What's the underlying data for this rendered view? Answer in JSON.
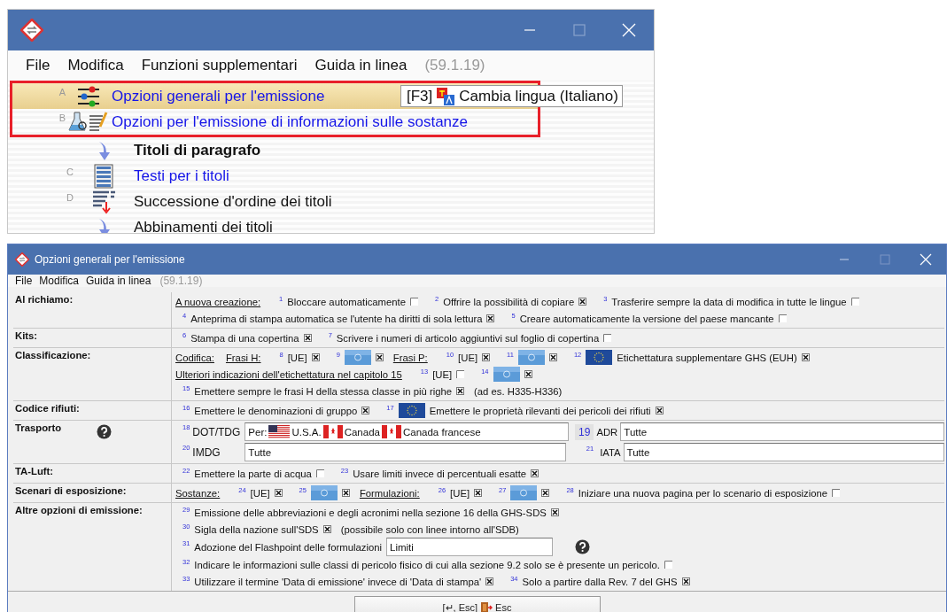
{
  "top_window": {
    "menu": [
      "File",
      "Modifica",
      "Funzioni supplementari",
      "Guida in linea"
    ],
    "version": "(59.1.19)",
    "highlighted_items": [
      {
        "letter": "A",
        "label": "Opzioni generali per l'emissione",
        "kind": "sliders",
        "selected": true
      },
      {
        "letter": "B",
        "label": "Opzioni per l'emissione di informazioni sulle sostanze",
        "kind": "flask",
        "selected": false
      }
    ],
    "items": [
      {
        "label": "Titoli di paragrafo",
        "kind": "heading",
        "selected": false
      },
      {
        "letter": "C",
        "label": "Testi per i titoli",
        "kind": "list",
        "selected": false
      },
      {
        "letter": "D",
        "label": "Successione d'ordine dei titoli",
        "kind": "sort",
        "selected": false
      },
      {
        "label": "Abbinamenti dei titoli",
        "kind": "merge",
        "selected": false
      }
    ],
    "tooltip": {
      "shortcut": "[F3]",
      "text": "Cambia lingua (Italiano)"
    }
  },
  "bottom_window": {
    "title": "Opzioni generali per l'emissione",
    "menu": [
      "File",
      "Modifica",
      "Guida in linea"
    ],
    "version": "(59.1.19)",
    "sections": [
      {
        "label": "Al richiamo:",
        "help": false,
        "lines": [
          [
            {
              "kind": "label",
              "text": "A nuova creazione:"
            },
            {
              "kind": "num",
              "text": "1"
            },
            {
              "kind": "text",
              "text": "Bloccare automaticamente"
            },
            {
              "kind": "check",
              "checked": false
            },
            {
              "kind": "num",
              "text": "2"
            },
            {
              "kind": "text",
              "text": "Offrire la possibilità di copiare"
            },
            {
              "kind": "check",
              "checked": true
            },
            {
              "kind": "num",
              "text": "3"
            },
            {
              "kind": "text",
              "text": "Trasferire sempre la data di modifica in tutte le lingue"
            },
            {
              "kind": "check",
              "checked": false
            }
          ],
          [
            {
              "kind": "num",
              "text": "4"
            },
            {
              "kind": "text",
              "text": "Anteprima di stampa automatica se l'utente ha diritti di sola lettura"
            },
            {
              "kind": "check",
              "checked": true
            },
            {
              "kind": "num",
              "text": "5"
            },
            {
              "kind": "text",
              "text": "Creare automaticamente la versione del paese mancante"
            },
            {
              "kind": "check",
              "checked": false
            }
          ]
        ]
      },
      {
        "label": "Kits:",
        "help": false,
        "lines": [
          [
            {
              "kind": "num",
              "text": "6"
            },
            {
              "kind": "text",
              "text": "Stampa di una copertina"
            },
            {
              "kind": "check",
              "checked": true
            },
            {
              "kind": "num",
              "text": "7"
            },
            {
              "kind": "text",
              "text": "Scrivere i numeri di articolo aggiuntivi sul foglio di copertina"
            },
            {
              "kind": "check",
              "checked": false
            }
          ]
        ]
      },
      {
        "label": "Classificazione:",
        "help": false,
        "lines": [
          [
            {
              "kind": "label",
              "text": "Codifica:"
            },
            {
              "kind": "label",
              "text": "Frasi H:"
            },
            {
              "kind": "num",
              "text": "8"
            },
            {
              "kind": "text",
              "text": "[UE]"
            },
            {
              "kind": "check",
              "checked": true
            },
            {
              "kind": "num",
              "text": "9"
            },
            {
              "kind": "un-flag"
            },
            {
              "kind": "check",
              "checked": true
            },
            {
              "kind": "label",
              "text": "Frasi P:"
            },
            {
              "kind": "num",
              "text": "10"
            },
            {
              "kind": "text",
              "text": "[UE]"
            },
            {
              "kind": "check",
              "checked": true
            },
            {
              "kind": "num",
              "text": "11"
            },
            {
              "kind": "un-flag"
            },
            {
              "kind": "check",
              "checked": true
            },
            {
              "kind": "num",
              "text": "12"
            },
            {
              "kind": "eu-flag"
            },
            {
              "kind": "text",
              "text": "Etichettatura supplementare GHS (EUH)"
            },
            {
              "kind": "check",
              "checked": true
            }
          ],
          [
            {
              "kind": "label",
              "text": "Ulteriori indicazioni dell'etichettatura nel capitolo 15"
            },
            {
              "kind": "num",
              "text": "13"
            },
            {
              "kind": "text",
              "text": "[UE]"
            },
            {
              "kind": "check",
              "checked": false
            },
            {
              "kind": "num",
              "text": "14"
            },
            {
              "kind": "un-flag"
            },
            {
              "kind": "check",
              "checked": true
            }
          ],
          [
            {
              "kind": "num",
              "text": "15"
            },
            {
              "kind": "text",
              "text": "Emettere sempre le frasi H della stessa classe in più righe"
            },
            {
              "kind": "check",
              "checked": true
            },
            {
              "kind": "text",
              "text": "(ad es. H335-H336)"
            }
          ]
        ]
      },
      {
        "label": "Codice rifiuti:",
        "help": false,
        "lines": [
          [
            {
              "kind": "num",
              "text": "16"
            },
            {
              "kind": "text",
              "text": "Emettere le denominazioni di gruppo"
            },
            {
              "kind": "check",
              "checked": true
            },
            {
              "kind": "num",
              "text": "17"
            },
            {
              "kind": "eu-flag"
            },
            {
              "kind": "text",
              "text": "Emettere le proprietà rilevanti dei pericoli dei rifiuti"
            },
            {
              "kind": "check",
              "checked": true
            }
          ]
        ]
      },
      {
        "label": "Trasporto",
        "help": true,
        "lines": [
          [
            {
              "kind": "num",
              "text": "18"
            },
            {
              "kind": "field-label",
              "text": "DOT/TDG"
            },
            {
              "kind": "rich-input",
              "parts": [
                {
                  "kind": "text",
                  "text": "Per:"
                },
                {
                  "kind": "us-flag"
                },
                {
                  "kind": "text",
                  "text": "U.S.A."
                },
                {
                  "kind": "ca-flag"
                },
                {
                  "kind": "text",
                  "text": "Canada"
                },
                {
                  "kind": "ca-flag"
                },
                {
                  "kind": "text",
                  "text": "Canada francese"
                }
              ]
            },
            {
              "kind": "numbox",
              "text": "19"
            },
            {
              "kind": "text",
              "text": "ADR"
            },
            {
              "kind": "input",
              "value": "Tutte"
            }
          ],
          [
            {
              "kind": "num",
              "text": "20"
            },
            {
              "kind": "field-label",
              "text": "IMDG"
            },
            {
              "kind": "input",
              "value": "Tutte"
            },
            {
              "kind": "numpad",
              "text": "21"
            },
            {
              "kind": "text",
              "text": "IATA"
            },
            {
              "kind": "input",
              "value": "Tutte"
            }
          ]
        ]
      },
      {
        "label": "TA-Luft:",
        "help": false,
        "lines": [
          [
            {
              "kind": "num",
              "text": "22"
            },
            {
              "kind": "text",
              "text": "Emettere la parte di acqua"
            },
            {
              "kind": "check",
              "checked": false
            },
            {
              "kind": "num",
              "text": "23"
            },
            {
              "kind": "text",
              "text": "Usare limiti invece di percentuali esatte"
            },
            {
              "kind": "check",
              "checked": true
            }
          ]
        ]
      },
      {
        "label": "Scenari di esposizione:",
        "help": false,
        "lines": [
          [
            {
              "kind": "label",
              "text": "Sostanze:"
            },
            {
              "kind": "num",
              "text": "24"
            },
            {
              "kind": "text",
              "text": "[UE]"
            },
            {
              "kind": "check",
              "checked": true
            },
            {
              "kind": "num",
              "text": "25"
            },
            {
              "kind": "un-flag"
            },
            {
              "kind": "check",
              "checked": true
            },
            {
              "kind": "label",
              "text": "Formulazioni:"
            },
            {
              "kind": "num",
              "text": "26"
            },
            {
              "kind": "text",
              "text": "[UE]"
            },
            {
              "kind": "check",
              "checked": true
            },
            {
              "kind": "num",
              "text": "27"
            },
            {
              "kind": "un-flag"
            },
            {
              "kind": "check",
              "checked": true
            },
            {
              "kind": "num",
              "text": "28"
            },
            {
              "kind": "text",
              "text": "Iniziare una nuova pagina per lo scenario di esposizione"
            },
            {
              "kind": "check",
              "checked": false
            }
          ]
        ]
      },
      {
        "label": "Altre opzioni di emissione:",
        "help": false,
        "lines": [
          [
            {
              "kind": "num",
              "text": "29"
            },
            {
              "kind": "text",
              "text": "Emissione delle abbreviazioni e degli acronimi nella sezione 16 della GHS-SDS"
            },
            {
              "kind": "check",
              "checked": true
            }
          ],
          [
            {
              "kind": "num",
              "text": "30"
            },
            {
              "kind": "text",
              "text": "Sigla della nazione sull'SDS"
            },
            {
              "kind": "check",
              "checked": true
            },
            {
              "kind": "text",
              "text": "(possibile solo con linee intorno all'SDB)"
            }
          ],
          [
            {
              "kind": "num",
              "text": "31"
            },
            {
              "kind": "text",
              "text": "Adozione del Flashpoint delle formulazioni"
            },
            {
              "kind": "short-input",
              "value": "Limiti"
            },
            {
              "kind": "help"
            }
          ],
          [
            {
              "kind": "num",
              "text": "32"
            },
            {
              "kind": "text",
              "text": "Indicare le informazioni sulle classi di pericolo fisico di cui alla sezione 9.2 solo se è presente un pericolo."
            },
            {
              "kind": "check",
              "checked": false
            }
          ],
          [
            {
              "kind": "num",
              "text": "33"
            },
            {
              "kind": "text",
              "text": "Utilizzare il termine 'Data di emissione' invece di 'Data di stampa'"
            },
            {
              "kind": "check",
              "checked": true
            },
            {
              "kind": "num",
              "text": "34"
            },
            {
              "kind": "text",
              "text": "Solo a partire dalla Rev. 7 del GHS"
            },
            {
              "kind": "check",
              "checked": true
            }
          ]
        ]
      }
    ],
    "button": {
      "shortcut": "[↵, Esc]",
      "label": "Esc"
    }
  }
}
